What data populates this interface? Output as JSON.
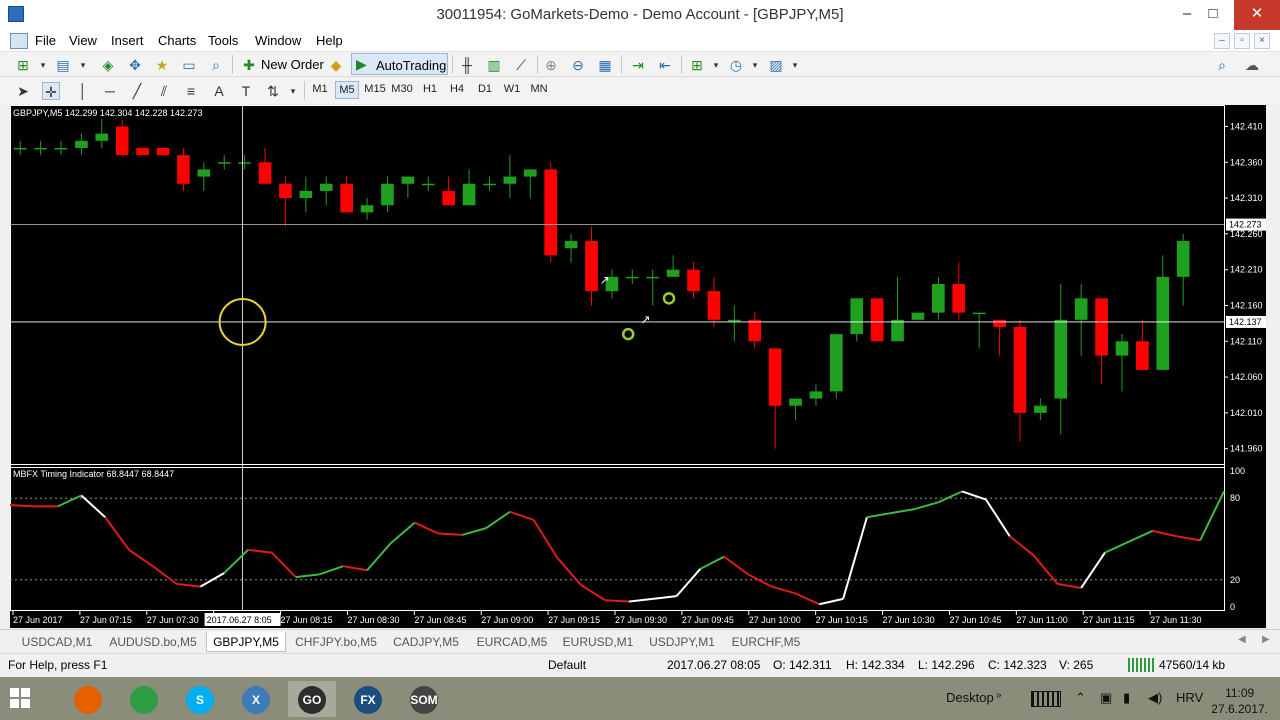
{
  "window": {
    "title": "30011954: GoMarkets-Demo - Demo Account - [GBPJPY,M5]",
    "minimize": "–",
    "maximize": "□",
    "close": "✕"
  },
  "menu": [
    "File",
    "View",
    "Insert",
    "Charts",
    "Tools",
    "Window",
    "Help"
  ],
  "toolbar": {
    "new_order": "New Order",
    "autotrading": "AutoTrading"
  },
  "timeframes": [
    "M1",
    "M5",
    "M15",
    "M30",
    "H1",
    "H4",
    "D1",
    "W1",
    "MN"
  ],
  "active_timeframe": "M5",
  "chart": {
    "header": "GBPJPY,M5  142.299 142.304 142.228 142.273",
    "bid_label": "142.273",
    "cursor_label": "142.137",
    "cursor_time": "2017.06.27 8:05",
    "price_ticks": [
      "142.410",
      "142.360",
      "142.310",
      "142.260",
      "142.210",
      "142.160",
      "142.110",
      "142.060",
      "142.010",
      "141.960"
    ],
    "indicator_header": "MBFX Timing Indicator 68.8447 68.8447",
    "indicator_ticks": [
      "100",
      "80",
      "20",
      "0"
    ],
    "time_ticks": [
      "27 Jun 2017",
      "27 Jun 07:15",
      "27 Jun 07:30",
      "27 Jun 07:4",
      "27 Jun 08:15",
      "27 Jun 08:30",
      "27 Jun 08:45",
      "27 Jun 09:00",
      "27 Jun 09:15",
      "27 Jun 09:30",
      "27 Jun 09:45",
      "27 Jun 10:00",
      "27 Jun 10:15",
      "27 Jun 10:30",
      "27 Jun 10:45",
      "27 Jun 11:00",
      "27 Jun 11:15",
      "27 Jun 11:30"
    ],
    "colors": {
      "bull": "#1fa01f",
      "bear": "#ff0000",
      "background": "#000000",
      "grid": "#ffffff"
    }
  },
  "chart_data": {
    "type": "candlestick",
    "ylim": [
      141.94,
      142.44
    ],
    "candles": [
      [
        142.38,
        142.39,
        142.37,
        142.38
      ],
      [
        142.38,
        142.39,
        142.37,
        142.38
      ],
      [
        142.38,
        142.39,
        142.37,
        142.38
      ],
      [
        142.38,
        142.4,
        142.37,
        142.39
      ],
      [
        142.39,
        142.42,
        142.38,
        142.4
      ],
      [
        142.41,
        142.42,
        142.37,
        142.37
      ],
      [
        142.38,
        142.38,
        142.37,
        142.37
      ],
      [
        142.38,
        142.38,
        142.37,
        142.37
      ],
      [
        142.37,
        142.38,
        142.32,
        142.33
      ],
      [
        142.34,
        142.36,
        142.32,
        142.35
      ],
      [
        142.36,
        142.37,
        142.35,
        142.36
      ],
      [
        142.36,
        142.37,
        142.35,
        142.36
      ],
      [
        142.36,
        142.38,
        142.33,
        142.33
      ],
      [
        142.33,
        142.34,
        142.27,
        142.31
      ],
      [
        142.31,
        142.34,
        142.29,
        142.32
      ],
      [
        142.32,
        142.34,
        142.3,
        142.33
      ],
      [
        142.33,
        142.34,
        142.29,
        142.29
      ],
      [
        142.29,
        142.31,
        142.28,
        142.3
      ],
      [
        142.3,
        142.34,
        142.29,
        142.33
      ],
      [
        142.33,
        142.34,
        142.31,
        142.34
      ],
      [
        142.33,
        142.34,
        142.32,
        142.33
      ],
      [
        142.32,
        142.34,
        142.3,
        142.3
      ],
      [
        142.3,
        142.35,
        142.3,
        142.33
      ],
      [
        142.33,
        142.34,
        142.32,
        142.33
      ],
      [
        142.33,
        142.37,
        142.31,
        142.34
      ],
      [
        142.34,
        142.35,
        142.31,
        142.35
      ],
      [
        142.35,
        142.36,
        142.22,
        142.23
      ],
      [
        142.24,
        142.26,
        142.22,
        142.25
      ],
      [
        142.25,
        142.27,
        142.16,
        142.18
      ],
      [
        142.18,
        142.21,
        142.17,
        142.2
      ],
      [
        142.2,
        142.21,
        142.19,
        142.2
      ],
      [
        142.2,
        142.21,
        142.16,
        142.2
      ],
      [
        142.2,
        142.23,
        142.2,
        142.21
      ],
      [
        142.21,
        142.22,
        142.17,
        142.18
      ],
      [
        142.18,
        142.2,
        142.13,
        142.14
      ],
      [
        142.14,
        142.16,
        142.11,
        142.14
      ],
      [
        142.14,
        142.15,
        142.1,
        142.11
      ],
      [
        142.1,
        142.1,
        141.96,
        142.02
      ],
      [
        142.02,
        142.03,
        142.0,
        142.03
      ],
      [
        142.03,
        142.05,
        142.02,
        142.04
      ],
      [
        142.04,
        142.12,
        142.03,
        142.12
      ],
      [
        142.12,
        142.17,
        142.11,
        142.17
      ],
      [
        142.17,
        142.17,
        142.11,
        142.11
      ],
      [
        142.11,
        142.2,
        142.11,
        142.14
      ],
      [
        142.14,
        142.15,
        142.14,
        142.15
      ],
      [
        142.15,
        142.2,
        142.14,
        142.19
      ],
      [
        142.19,
        142.22,
        142.14,
        142.15
      ],
      [
        142.15,
        142.15,
        142.1,
        142.15
      ],
      [
        142.14,
        142.14,
        142.09,
        142.13
      ],
      [
        142.13,
        142.14,
        141.97,
        142.01
      ],
      [
        142.01,
        142.03,
        142.0,
        142.02
      ],
      [
        142.03,
        142.19,
        141.98,
        142.14
      ],
      [
        142.14,
        142.19,
        142.09,
        142.17
      ],
      [
        142.17,
        142.17,
        142.05,
        142.09
      ],
      [
        142.09,
        142.12,
        142.04,
        142.11
      ],
      [
        142.11,
        142.14,
        142.07,
        142.07
      ],
      [
        142.07,
        142.23,
        142.07,
        142.2
      ],
      [
        142.2,
        142.26,
        142.16,
        142.25
      ]
    ],
    "indicator": {
      "name": "MBFX Timing Indicator",
      "ylim": [
        0,
        100
      ],
      "levels": [
        80,
        20
      ],
      "values": [
        75,
        74,
        74,
        82,
        66,
        42,
        30,
        17,
        15,
        25,
        42,
        40,
        22,
        24,
        30,
        27,
        47,
        62,
        54,
        53,
        58,
        70,
        64,
        36,
        16,
        5,
        4,
        6,
        8,
        28,
        37,
        24,
        15,
        10,
        2,
        6,
        66,
        69,
        72,
        77,
        85,
        79,
        52,
        38,
        17,
        14,
        40,
        48,
        56,
        52,
        49,
        85
      ]
    }
  },
  "tabs": [
    "USDCAD,M1",
    "AUDUSD.bo,M5",
    "GBPJPY,M5",
    "CHFJPY.bo,M5",
    "CADJPY,M5",
    "EURCAD,M5",
    "EURUSD,M1",
    "USDJPY,M1",
    "EURCHF,M5"
  ],
  "active_tab": "GBPJPY,M5",
  "status": {
    "help": "For Help, press F1",
    "profile": "Default",
    "datetime": "2017.06.27 08:05",
    "open": "O: 142.311",
    "high": "H: 142.334",
    "low": "L: 142.296",
    "close": "C: 142.323",
    "volume": "V: 265",
    "traffic": "47560/14 kb"
  },
  "taskbar": {
    "desktop": "Desktop",
    "lang": "HRV",
    "time": "11:09",
    "date": "27.6.2017.",
    "apps": [
      {
        "name": "firefox-icon",
        "color": "#e66000",
        "label": ""
      },
      {
        "name": "chrome-icon",
        "color": "#2e9d42",
        "label": ""
      },
      {
        "name": "skype-icon",
        "color": "#00aff0",
        "label": "S"
      },
      {
        "name": "x-app-icon",
        "color": "#3c7db8",
        "label": "X"
      },
      {
        "name": "go-app-icon",
        "color": "#2d2d2d",
        "label": "GO"
      },
      {
        "name": "fx-app-icon",
        "color": "#1c4d80",
        "label": "FX"
      },
      {
        "name": "som-app-icon",
        "color": "#444444",
        "label": "SOM"
      }
    ]
  }
}
